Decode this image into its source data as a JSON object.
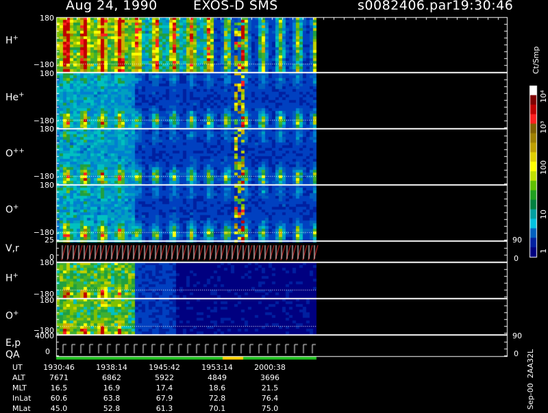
{
  "header": {
    "date": "Aug 24, 1990",
    "instrument": "EXOS-D SMS",
    "file": "s0082406.par",
    "time": "19:30:46"
  },
  "panels": [
    {
      "label": "H",
      "sup": "+",
      "top": "180",
      "bottom": "−180"
    },
    {
      "label": "He",
      "sup": "+",
      "top": "180",
      "bottom": "−180"
    },
    {
      "label": "O",
      "sup": "++",
      "top": "180",
      "bottom": "−180"
    },
    {
      "label": "O",
      "sup": "+",
      "top": "180",
      "bottom": "−180"
    },
    {
      "label": "V,r",
      "sup": "",
      "top": "25",
      "bottom": "0",
      "right_top": "90",
      "right_bottom": "0"
    },
    {
      "label": "H",
      "sup": "+",
      "top": "180",
      "bottom": "−180"
    },
    {
      "label": "O",
      "sup": "+",
      "top": "180",
      "bottom": "−180"
    },
    {
      "label": "E,p",
      "sup": "",
      "top": "4000",
      "bottom": "",
      "right_top": "90",
      "right_bottom": "0"
    }
  ],
  "qa_label": "QA",
  "qa_zero": "0",
  "colorbar": {
    "unit": "Ct/Smp",
    "ticks": [
      "10⁴",
      "10³",
      "100",
      "10",
      "1"
    ],
    "colors": [
      "#ffffff",
      "#800000",
      "#c00000",
      "#ff2020",
      "#806000",
      "#a08000",
      "#c0a000",
      "#e0d000",
      "#ffff00",
      "#c0e000",
      "#60c000",
      "#20a020",
      "#008040",
      "#00a0a0",
      "#00c0e0",
      "#0060c0",
      "#0020a0",
      "#000080"
    ]
  },
  "side_note": "Sep-00  2AA32L",
  "axis": {
    "rows": [
      "UT",
      "ALT",
      "MLT",
      "InLat",
      "MLat"
    ],
    "columns": [
      [
        "1930:46",
        "7671",
        "16.5",
        "60.6",
        "45.0"
      ],
      [
        "1938:14",
        "6862",
        "16.9",
        "63.8",
        "52.8"
      ],
      [
        "1945:42",
        "5922",
        "17.4",
        "67.9",
        "61.3"
      ],
      [
        "1953:14",
        "4849",
        "18.6",
        "72.8",
        "70.1"
      ],
      [
        "2000:38",
        "3696",
        "21.5",
        "76.4",
        "75.0"
      ]
    ]
  },
  "chart_data": {
    "type": "heatmap",
    "title": "Aug 24, 1990   EXOS-D SMS",
    "x_ticks_ut": [
      "1930:46",
      "1938:14",
      "1945:42",
      "1953:14",
      "2000:38"
    ],
    "y_range": [
      -180,
      180
    ],
    "colorbar_range": [
      1,
      10000
    ],
    "colorbar_scale": "log",
    "species_panels": [
      "H+",
      "He+",
      "O++",
      "O+",
      "H+",
      "O+"
    ]
  }
}
